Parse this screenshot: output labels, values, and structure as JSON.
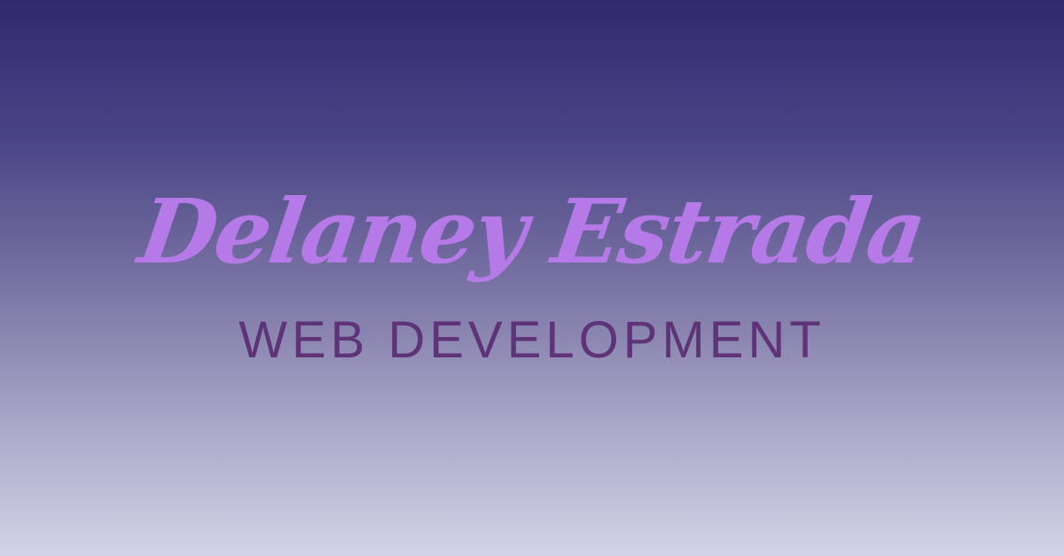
{
  "brand": {
    "name": "Delaney Estrada",
    "tagline": "WEB DEVELOPMENT"
  },
  "colors": {
    "name": "#b57ae8",
    "tagline": "#5e3378",
    "background_top": "#32296f",
    "background_bottom": "#d4d2e6"
  }
}
